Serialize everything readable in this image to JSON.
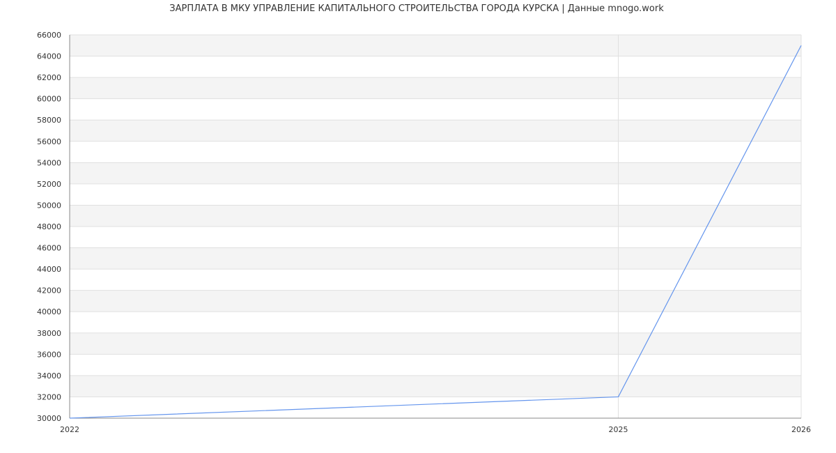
{
  "chart_data": {
    "type": "line",
    "title": "ЗАРПЛАТА В МКУ УПРАВЛЕНИЕ КАПИТАЛЬНОГО СТРОИТЕЛЬСТВА ГОРОДА КУРСКА | Данные mnogo.work",
    "xlabel": "",
    "ylabel": "",
    "x": [
      2022,
      2025,
      2026
    ],
    "x_tick_labels": [
      "2022",
      "2025",
      "2026"
    ],
    "series": [
      {
        "values": [
          30000,
          32000,
          65000
        ]
      }
    ],
    "xlim": [
      2022,
      2026
    ],
    "ylim": [
      30000,
      66000
    ],
    "y_ticks": [
      30000,
      32000,
      34000,
      36000,
      38000,
      40000,
      42000,
      44000,
      46000,
      48000,
      50000,
      52000,
      54000,
      56000,
      58000,
      60000,
      62000,
      64000,
      66000
    ],
    "grid": true,
    "legend": "none",
    "colors": {
      "line": "#6495ed",
      "band": "#f4f4f4",
      "grid": "#e0e0e0",
      "axis": "#888888",
      "text": "#333333"
    }
  }
}
